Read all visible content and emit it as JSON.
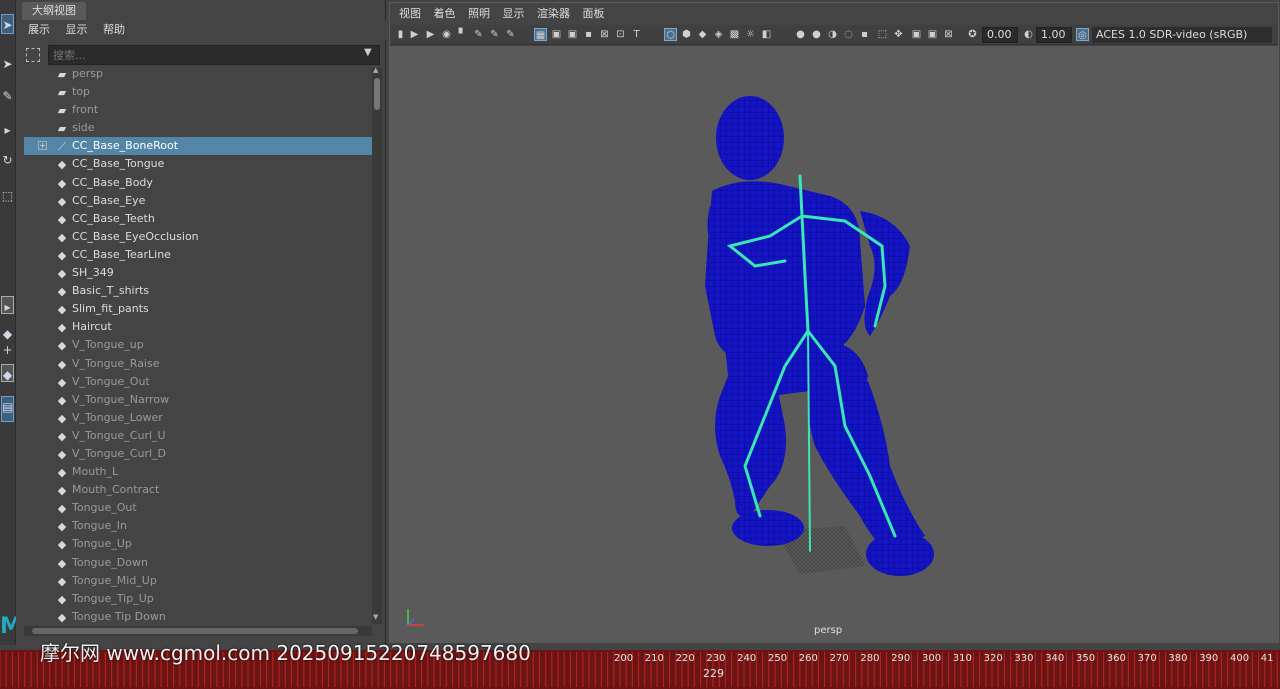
{
  "outliner": {
    "tab_title": "大纲视图",
    "menu": [
      "展示",
      "显示",
      "帮助"
    ],
    "search_placeholder": "搜索...",
    "items": [
      {
        "label": "persp",
        "icon": "camera-icon",
        "dim": true
      },
      {
        "label": "top",
        "icon": "camera-icon",
        "dim": true
      },
      {
        "label": "front",
        "icon": "camera-icon",
        "dim": true
      },
      {
        "label": "side",
        "icon": "camera-icon",
        "dim": true
      },
      {
        "label": "CC_Base_BoneRoot",
        "icon": "joint-icon",
        "selected": true,
        "expandable": true
      },
      {
        "label": "CC_Base_Tongue",
        "icon": "transform-icon"
      },
      {
        "label": "CC_Base_Body",
        "icon": "transform-icon"
      },
      {
        "label": "CC_Base_Eye",
        "icon": "transform-icon"
      },
      {
        "label": "CC_Base_Teeth",
        "icon": "transform-icon"
      },
      {
        "label": "CC_Base_EyeOcclusion",
        "icon": "transform-icon"
      },
      {
        "label": "CC_Base_TearLine",
        "icon": "transform-icon"
      },
      {
        "label": "SH_349",
        "icon": "transform-icon"
      },
      {
        "label": "Basic_T_shirts",
        "icon": "transform-icon"
      },
      {
        "label": "Slim_fit_pants",
        "icon": "transform-icon"
      },
      {
        "label": "Haircut",
        "icon": "transform-icon"
      },
      {
        "label": "V_Tongue_up",
        "icon": "transform-icon",
        "dim": true
      },
      {
        "label": "V_Tongue_Raise",
        "icon": "transform-icon",
        "dim": true
      },
      {
        "label": "V_Tongue_Out",
        "icon": "transform-icon",
        "dim": true
      },
      {
        "label": "V_Tongue_Narrow",
        "icon": "transform-icon",
        "dim": true
      },
      {
        "label": "V_Tongue_Lower",
        "icon": "transform-icon",
        "dim": true
      },
      {
        "label": "V_Tongue_Curl_U",
        "icon": "transform-icon",
        "dim": true
      },
      {
        "label": "V_Tongue_Curl_D",
        "icon": "transform-icon",
        "dim": true
      },
      {
        "label": "Mouth_L",
        "icon": "transform-icon",
        "dim": true
      },
      {
        "label": "Mouth_Contract",
        "icon": "transform-icon",
        "dim": true
      },
      {
        "label": "Tongue_Out",
        "icon": "transform-icon",
        "dim": true
      },
      {
        "label": "Tongue_In",
        "icon": "transform-icon",
        "dim": true
      },
      {
        "label": "Tongue_Up",
        "icon": "transform-icon",
        "dim": true
      },
      {
        "label": "Tongue_Down",
        "icon": "transform-icon",
        "dim": true
      },
      {
        "label": "Tongue_Mid_Up",
        "icon": "transform-icon",
        "dim": true
      },
      {
        "label": "Tongue_Tip_Up",
        "icon": "transform-icon",
        "dim": true
      },
      {
        "label": "Tongue Tip Down",
        "icon": "transform-icon",
        "dim": true
      }
    ]
  },
  "viewport": {
    "menu": [
      "视图",
      "着色",
      "照明",
      "显示",
      "渲染器",
      "面板"
    ],
    "exposure": "0.00",
    "gamma": "1.00",
    "color_management": "ACES 1.0 SDR-video (sRGB)",
    "camera_label": "persp",
    "wireframe_color": "#0a0aa8",
    "skeleton_color": "#39e6b4"
  },
  "timeline": {
    "ticks": [
      "200",
      "210",
      "220",
      "230",
      "240",
      "250",
      "260",
      "270",
      "280",
      "290",
      "300",
      "310",
      "320",
      "330",
      "340",
      "350",
      "360",
      "370",
      "380",
      "390",
      "400",
      "41"
    ],
    "current_frame": "229",
    "color": "#6a1414"
  },
  "watermark": {
    "text": "摩尔网 www.cgmol.com 20250915220748597680"
  }
}
